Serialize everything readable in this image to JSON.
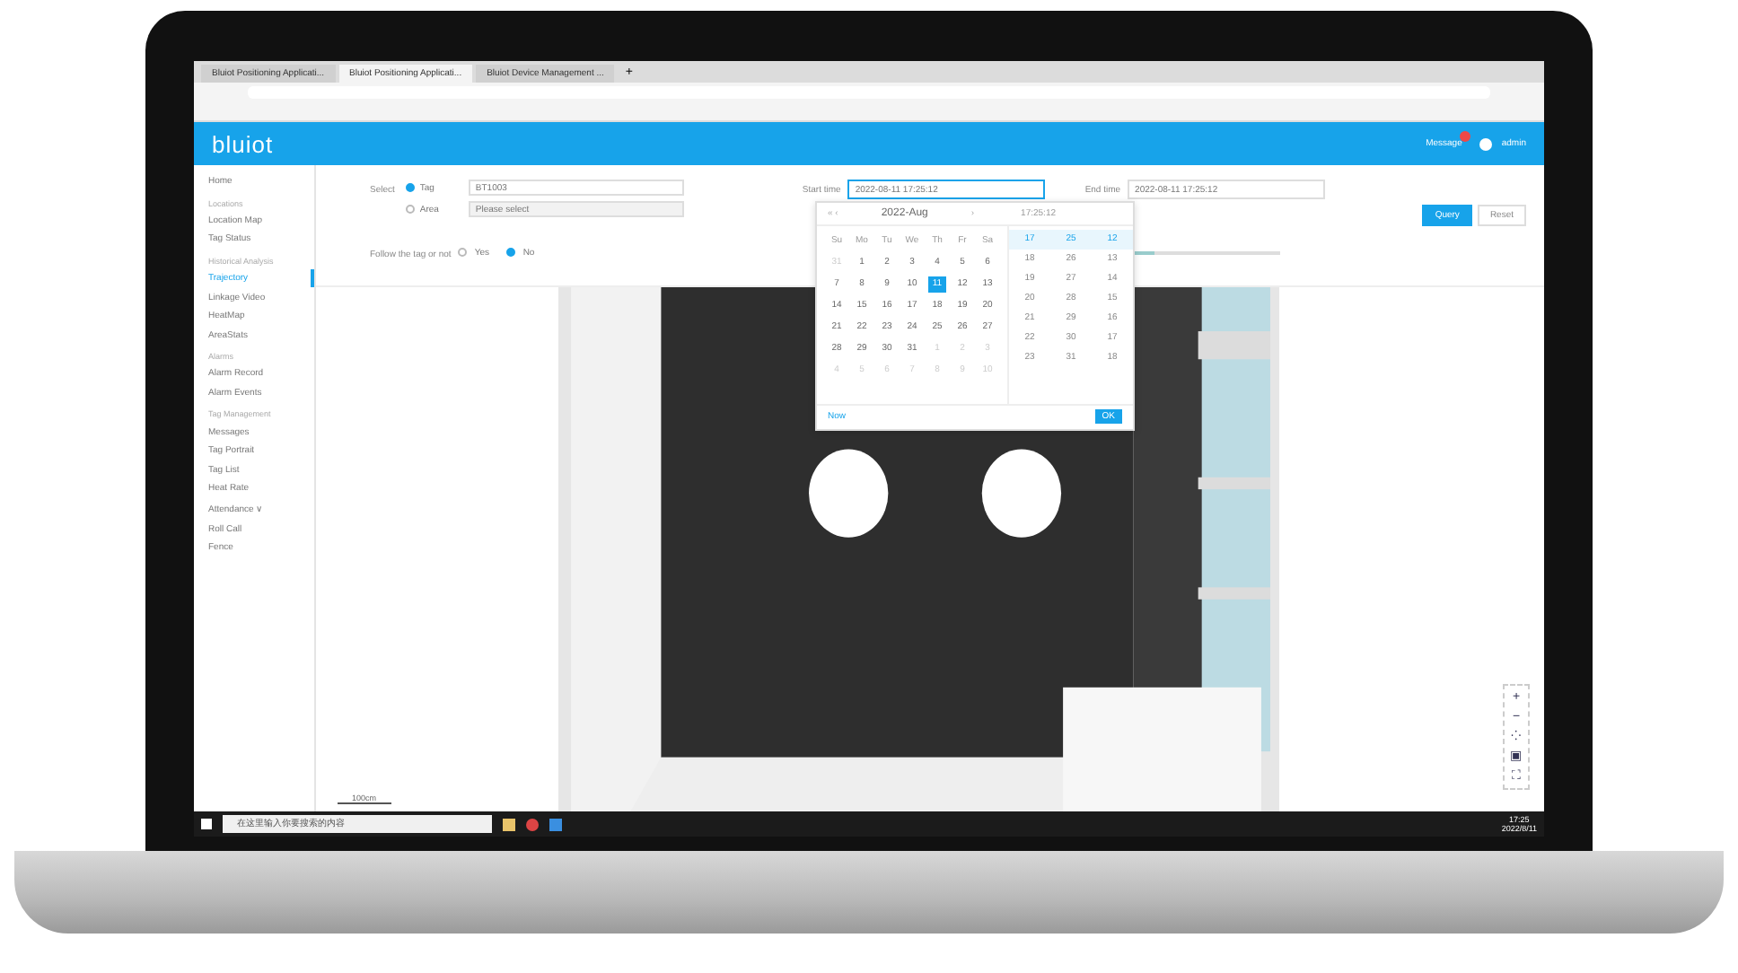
{
  "browser": {
    "tabs": [
      {
        "label": "Bluiot Positioning Applicati...",
        "selected": false
      },
      {
        "label": "Bluiot Positioning Applicati...",
        "selected": true
      },
      {
        "label": "Bluiot Device Management ...",
        "selected": false
      }
    ],
    "new_tab": "+"
  },
  "app": {
    "logo": "bluiot",
    "header_items": [
      "Message",
      "admin"
    ],
    "badge_on": true
  },
  "sidebar": [
    {
      "kind": "item",
      "label": "Home",
      "selected": false
    },
    {
      "kind": "section",
      "label": "Locations"
    },
    {
      "kind": "item",
      "label": "Location Map",
      "selected": false
    },
    {
      "kind": "item",
      "label": "Tag Status",
      "selected": false
    },
    {
      "kind": "section",
      "label": "Historical Analysis"
    },
    {
      "kind": "item",
      "label": "Trajectory",
      "selected": true
    },
    {
      "kind": "item",
      "label": "Linkage Video",
      "selected": false
    },
    {
      "kind": "item",
      "label": "HeatMap",
      "selected": false
    },
    {
      "kind": "item",
      "label": "AreaStats",
      "selected": false
    },
    {
      "kind": "section",
      "label": "Alarms"
    },
    {
      "kind": "item",
      "label": "Alarm Record",
      "selected": false
    },
    {
      "kind": "item",
      "label": "Alarm Events",
      "selected": false
    },
    {
      "kind": "section",
      "label": "Tag Management"
    },
    {
      "kind": "item",
      "label": "Messages",
      "selected": false
    },
    {
      "kind": "item",
      "label": "Tag Portrait",
      "selected": false
    },
    {
      "kind": "item",
      "label": "Tag List",
      "selected": false
    },
    {
      "kind": "item",
      "label": "Heat Rate",
      "selected": false
    },
    {
      "kind": "item",
      "label": "Attendance ∨",
      "selected": false
    },
    {
      "kind": "item",
      "label": "Roll Call",
      "selected": false
    },
    {
      "kind": "item",
      "label": "Fence",
      "selected": false
    }
  ],
  "filter": {
    "select_label": "Select",
    "targets": [
      {
        "label": "Tag",
        "selected": true,
        "value": "BT1003"
      },
      {
        "label": "Area",
        "selected": false,
        "placeholder": "Please select"
      }
    ],
    "start_label": "Start time",
    "start_value": "2022-08-11 17:25:12",
    "end_label": "End time",
    "end_value": "2022-08-11 17:25:12",
    "follow_label": "Follow the tag or not",
    "follow_options": [
      {
        "label": "Yes",
        "selected": false
      },
      {
        "label": "No",
        "selected": true
      }
    ],
    "slider": {
      "level": 0.3
    },
    "buttons": [
      "Query",
      "Reset"
    ]
  },
  "calendar": {
    "prev": "« ‹",
    "month": "2022-Aug",
    "next": "›",
    "time_title": "17:25:12",
    "weekdays": [
      "Su",
      "Mo",
      "Tu",
      "We",
      "Th",
      "Fr",
      "Sa"
    ],
    "days": [
      {
        "label": "31",
        "muted": true,
        "selected": false
      },
      {
        "label": "1",
        "muted": false,
        "selected": false
      },
      {
        "label": "2",
        "muted": false,
        "selected": false
      },
      {
        "label": "3",
        "muted": false,
        "selected": false
      },
      {
        "label": "4",
        "muted": false,
        "selected": false
      },
      {
        "label": "5",
        "muted": false,
        "selected": false
      },
      {
        "label": "6",
        "muted": false,
        "selected": false
      },
      {
        "label": "7",
        "muted": false,
        "selected": false
      },
      {
        "label": "8",
        "muted": false,
        "selected": false
      },
      {
        "label": "9",
        "muted": false,
        "selected": false
      },
      {
        "label": "10",
        "muted": false,
        "selected": false
      },
      {
        "label": "11",
        "muted": false,
        "selected": true
      },
      {
        "label": "12",
        "muted": false,
        "selected": false
      },
      {
        "label": "13",
        "muted": false,
        "selected": false
      },
      {
        "label": "14",
        "muted": false,
        "selected": false
      },
      {
        "label": "15",
        "muted": false,
        "selected": false
      },
      {
        "label": "16",
        "muted": false,
        "selected": false
      },
      {
        "label": "17",
        "muted": false,
        "selected": false
      },
      {
        "label": "18",
        "muted": false,
        "selected": false
      },
      {
        "label": "19",
        "muted": false,
        "selected": false
      },
      {
        "label": "20",
        "muted": false,
        "selected": false
      },
      {
        "label": "21",
        "muted": false,
        "selected": false
      },
      {
        "label": "22",
        "muted": false,
        "selected": false
      },
      {
        "label": "23",
        "muted": false,
        "selected": false
      },
      {
        "label": "24",
        "muted": false,
        "selected": false
      },
      {
        "label": "25",
        "muted": false,
        "selected": false
      },
      {
        "label": "26",
        "muted": false,
        "selected": false
      },
      {
        "label": "27",
        "muted": false,
        "selected": false
      },
      {
        "label": "28",
        "muted": false,
        "selected": false
      },
      {
        "label": "29",
        "muted": false,
        "selected": false
      },
      {
        "label": "30",
        "muted": false,
        "selected": false
      },
      {
        "label": "31",
        "muted": false,
        "selected": false
      },
      {
        "label": "1",
        "muted": true,
        "selected": false
      },
      {
        "label": "2",
        "muted": true,
        "selected": false
      },
      {
        "label": "3",
        "muted": true,
        "selected": false
      },
      {
        "label": "4",
        "muted": true,
        "selected": false
      },
      {
        "label": "5",
        "muted": true,
        "selected": false
      },
      {
        "label": "6",
        "muted": true,
        "selected": false
      },
      {
        "label": "7",
        "muted": true,
        "selected": false
      },
      {
        "label": "8",
        "muted": true,
        "selected": false
      },
      {
        "label": "9",
        "muted": true,
        "selected": false
      },
      {
        "label": "10",
        "muted": true,
        "selected": false
      }
    ],
    "time_rows": [
      {
        "cells": [
          "17",
          "25",
          "12"
        ],
        "selected": true
      },
      {
        "cells": [
          "18",
          "26",
          "13"
        ],
        "selected": false
      },
      {
        "cells": [
          "19",
          "27",
          "14"
        ],
        "selected": false
      },
      {
        "cells": [
          "20",
          "28",
          "15"
        ],
        "selected": false
      },
      {
        "cells": [
          "21",
          "29",
          "16"
        ],
        "selected": false
      },
      {
        "cells": [
          "22",
          "30",
          "17"
        ],
        "selected": false
      },
      {
        "cells": [
          "23",
          "31",
          "18"
        ],
        "selected": false
      }
    ],
    "now": "Now",
    "ok": "OK"
  },
  "map": {
    "scale": "100cm",
    "controls": [
      "+",
      "−",
      "⁘",
      "▣",
      "⛶"
    ]
  },
  "taskbar": {
    "search": "在这里输入你要搜索的内容",
    "time": "17:25",
    "date": "2022/8/11"
  }
}
